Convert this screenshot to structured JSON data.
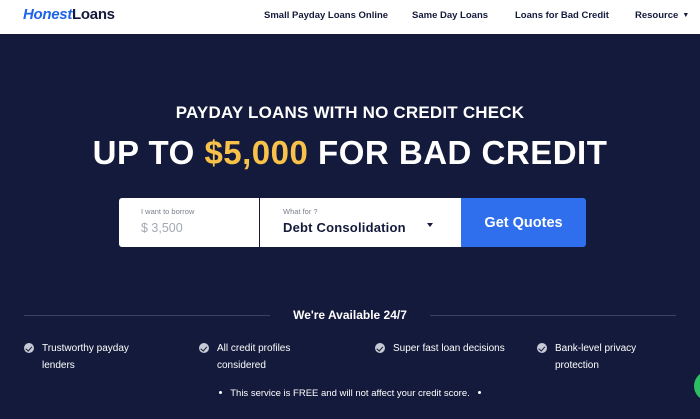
{
  "header": {
    "logo_part1": "Honest",
    "logo_part2": "Loans",
    "nav": [
      {
        "label": "Small Payday Loans Online"
      },
      {
        "label": "Same Day Loans"
      },
      {
        "label": "Loans for Bad Credit"
      },
      {
        "label": "Resource"
      }
    ]
  },
  "hero": {
    "eyebrow": "PAYDAY LOANS WITH NO CREDIT CHECK",
    "headline_prefix": "UP TO ",
    "headline_amount": "$5,000",
    "headline_suffix": " FOR BAD CREDIT"
  },
  "form": {
    "borrow_label": "I want to borrow",
    "borrow_placeholder": "$ 3,500",
    "purpose_label": "What for ?",
    "purpose_value": "Debt Consolidation",
    "cta_label": "Get Quotes"
  },
  "availability": {
    "title": "We're Available 24/7",
    "features": [
      {
        "text": "Trustworthy payday lenders"
      },
      {
        "text": "All credit profiles considered"
      },
      {
        "text": "Super fast loan decisions"
      },
      {
        "text": "Bank-level privacy protection"
      }
    ],
    "note": "This service is FREE and will not affect your credit score."
  },
  "colors": {
    "background": "#141a3b",
    "accent_blue": "#2f6fee",
    "amount_yellow": "#f7c14a",
    "chat_green": "#2dbe63"
  },
  "icons": {
    "check": "check-circle-icon",
    "caret": "caret-down-icon",
    "chat": "chat-icon"
  }
}
